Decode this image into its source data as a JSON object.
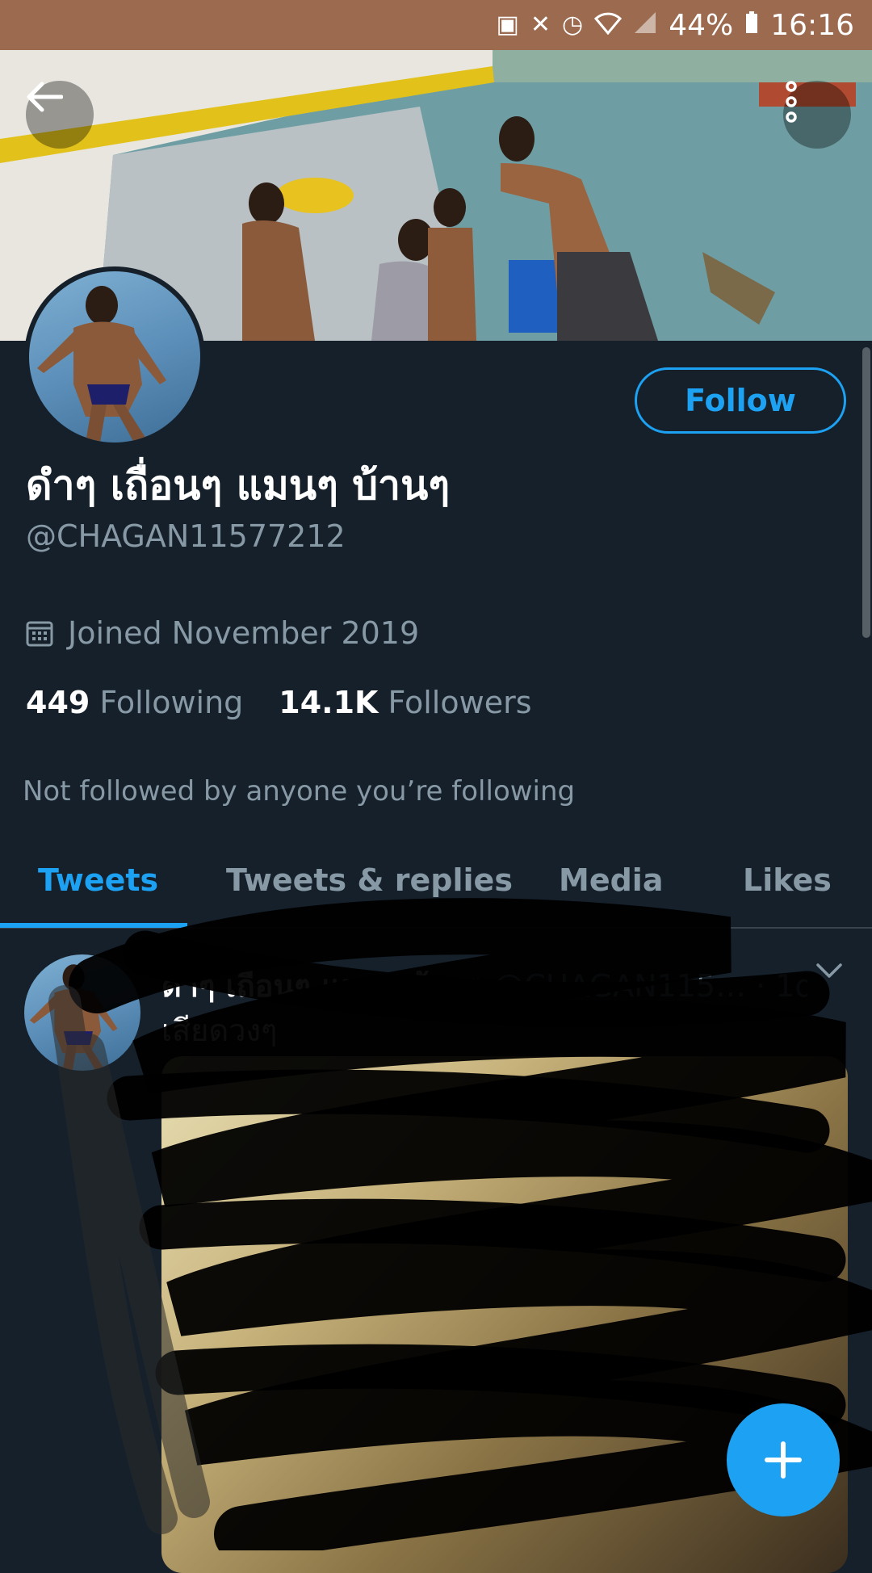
{
  "status_bar": {
    "battery": "44%",
    "time": "16:16",
    "icons": [
      "notification-icon",
      "vibrate-mute-icon",
      "alarm-icon",
      "wifi-icon",
      "signal-icon",
      "battery-icon"
    ]
  },
  "header": {
    "back_icon": "arrow-left-icon",
    "more_icon": "more-vertical-icon"
  },
  "profile": {
    "display_name": "ดำๆ เถื่อนๆ แมนๆ บ้านๆ",
    "handle": "@CHAGAN11577212",
    "follow_label": "Follow",
    "joined": "Joined November 2019",
    "following_count": "449",
    "following_label": "Following",
    "followers_count": "14.1K",
    "followers_label": "Followers",
    "not_followed": "Not followed by anyone you’re following"
  },
  "tabs": [
    {
      "label": "Tweets",
      "active": true
    },
    {
      "label": "Tweets & replies",
      "active": false
    },
    {
      "label": "Media",
      "active": false
    },
    {
      "label": "Likes",
      "active": false
    }
  ],
  "tweet": {
    "name": "ดำๆ เถื่อนๆ แมนๆ บ้านๆ",
    "handle": "@CHAGAN115…",
    "time": "· 1d",
    "text": "เสียดวงๆ"
  },
  "colors": {
    "background": "#15202b",
    "accent": "#1da1f2",
    "muted_text": "#8899a6",
    "status_bar": "#9b6a4f"
  }
}
